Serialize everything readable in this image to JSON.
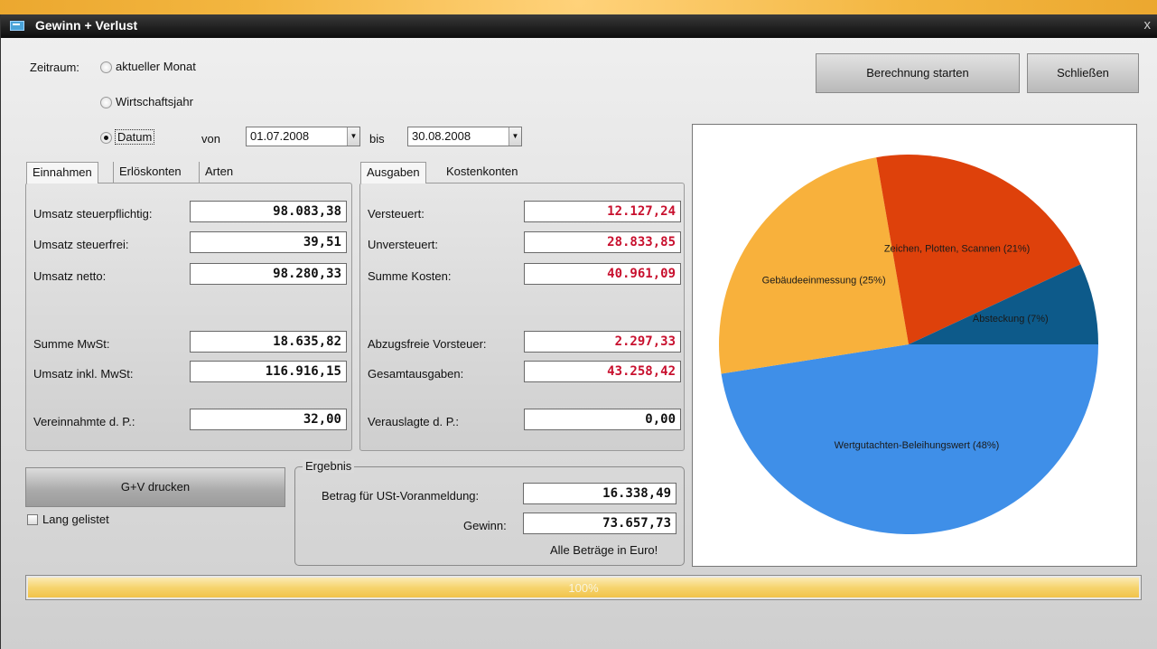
{
  "window": {
    "title": "Gewinn + Verlust",
    "close": "x"
  },
  "period": {
    "label": "Zeitraum:",
    "options": [
      "aktueller Monat",
      "Wirtschaftsjahr",
      "Datum"
    ],
    "selected": "Datum",
    "from_label": "von",
    "from_value": "01.07.2008",
    "to_label": "bis",
    "to_value": "30.08.2008"
  },
  "buttons": {
    "start": "Berechnung starten",
    "close": "Schließen",
    "print": "G+V drucken"
  },
  "income": {
    "tabs": [
      "Einnahmen",
      "Erlöskonten",
      "Arten"
    ],
    "rows": [
      {
        "label": "Umsatz steuerpflichtig:",
        "value": "98.083,38"
      },
      {
        "label": "Umsatz steuerfrei:",
        "value": "39,51"
      },
      {
        "label": "Umsatz netto:",
        "value": "98.280,33"
      },
      {
        "label": "Summe MwSt:",
        "value": "18.635,82"
      },
      {
        "label": "Umsatz inkl. MwSt:",
        "value": "116.916,15"
      },
      {
        "label": "Vereinnahmte d. P.:",
        "value": "32,00"
      }
    ]
  },
  "expenses": {
    "tabs": [
      "Ausgaben",
      "Kostenkonten"
    ],
    "rows": [
      {
        "label": "Versteuert:",
        "value": "12.127,24"
      },
      {
        "label": "Unversteuert:",
        "value": "28.833,85"
      },
      {
        "label": "Summe Kosten:",
        "value": "40.961,09"
      },
      {
        "label": "Abzugsfreie Vorsteuer:",
        "value": "2.297,33"
      },
      {
        "label": "Gesamtausgaben:",
        "value": "43.258,42"
      },
      {
        "label": "Verauslagte d. P.:",
        "value": "0,00"
      }
    ]
  },
  "print_options": {
    "long_list_label": "Lang gelistet",
    "long_list_checked": false
  },
  "result": {
    "legend": "Ergebnis",
    "vat_label": "Betrag für USt-Voranmeldung:",
    "vat_value": "16.338,49",
    "profit_label": "Gewinn:",
    "profit_value": "73.657,73",
    "note": "Alle Beträge in Euro!"
  },
  "progress": {
    "percent": 100,
    "label": "100%"
  },
  "colors": {
    "red_value": "#c8102e",
    "progress_fill": "#f6d46e"
  },
  "chart_data": {
    "type": "pie",
    "slices": [
      {
        "label": "Wertgutachten-Beleihungswert (48%)",
        "value": 48,
        "color": "#3f8fe8"
      },
      {
        "label": "Gebäudeeinmessung (25%)",
        "value": 25,
        "color": "#f8b13c"
      },
      {
        "label": "Zeichen, Plotten, Scannen (21%)",
        "value": 21,
        "color": "#de410b"
      },
      {
        "label": "Absteckung (7%)",
        "value": 7,
        "color": "#0d5a8a"
      }
    ]
  }
}
